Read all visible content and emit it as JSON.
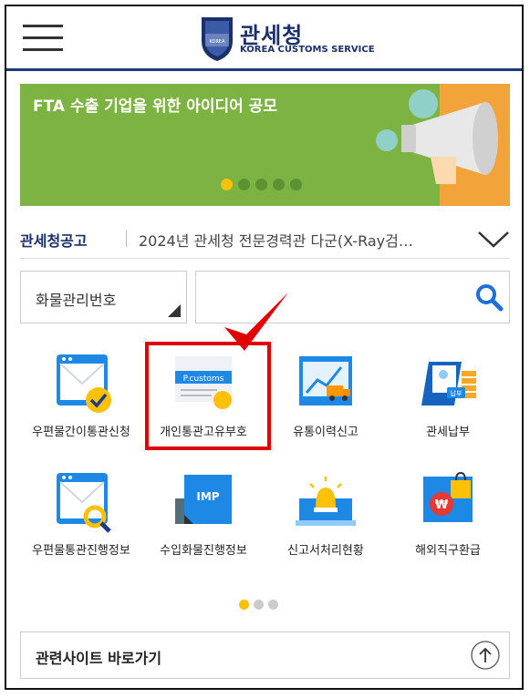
{
  "header": {
    "title": "관세청",
    "subtitle": "KOREA CUSTOMS SERVICE",
    "emblem_text": "KOREA CUSTOMS SERVICE",
    "brand_color": "#1b2f68"
  },
  "banner": {
    "text": "FTA 수출 기업을 위한 아이디어 공모",
    "active_slide": 1,
    "slide_count": 5
  },
  "notice": {
    "label": "관세청공고",
    "text": "2024년 관세청 전문경력관 다군(X-Ray검…"
  },
  "search": {
    "select_value": "화물관리번호",
    "placeholder": ""
  },
  "menu": {
    "items": [
      {
        "label": "우편물간이통관신청",
        "icon": "mail-check-icon"
      },
      {
        "label": "개인통관고유부호",
        "icon": "p-customs-card-icon",
        "badge": "P.customs"
      },
      {
        "label": "유통이력신고",
        "icon": "truck-chart-icon"
      },
      {
        "label": "관세납부",
        "icon": "tax-payment-icon",
        "badge": "납부"
      },
      {
        "label": "우편물통관진행정보",
        "icon": "mail-search-icon"
      },
      {
        "label": "수입화물진행정보",
        "icon": "imp-document-icon",
        "badge": "IMP"
      },
      {
        "label": "신고서처리현황",
        "icon": "alarm-laptop-icon"
      },
      {
        "label": "해외직구환급",
        "icon": "shopping-bag-refund-icon"
      }
    ],
    "highlighted": "개인통관고유부호",
    "page_active": 1,
    "page_count": 3
  },
  "related": {
    "label": "관련사이트 바로가기"
  },
  "colors": {
    "accent": "#ffc107",
    "banner_bg": "#7cb342",
    "highlight": "#e00000",
    "icon_blue": "#1e88e5"
  }
}
